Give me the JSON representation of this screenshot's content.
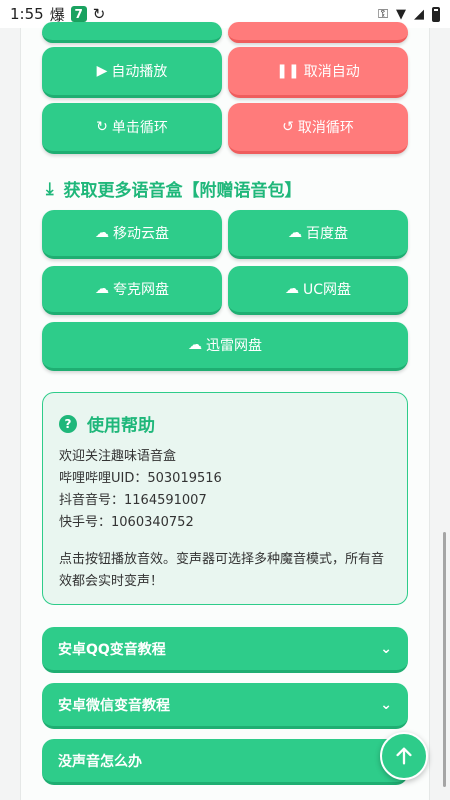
{
  "status_bar": {
    "time": "1:55",
    "badge_char": "7",
    "notif_char": "爆"
  },
  "controls": {
    "auto_play": "自动播放",
    "cancel_auto": "取消自动",
    "single_loop": "单击循环",
    "cancel_loop": "取消循环"
  },
  "download_section": {
    "title": "获取更多语音盒【附赠语音包】",
    "buttons": [
      "移动云盘",
      "百度盘",
      "夸克网盘",
      "UC网盘",
      "迅雷网盘"
    ]
  },
  "help": {
    "title": "使用帮助",
    "lines": [
      "欢迎关注趣味语音盒",
      "哔哩哔哩UID：503019516",
      "抖音音号：1164591007",
      "快手号：1060340752"
    ],
    "description": "点击按钮播放音效。变声器可选择多种魔音模式，所有音效都会实时变声！"
  },
  "accordions": [
    "安卓QQ变音教程",
    "安卓微信变音教程",
    "没声音怎么办"
  ],
  "colors": {
    "green": "#2ecc8a",
    "red": "#ff7b7b",
    "accent_text": "#1fb77a"
  }
}
